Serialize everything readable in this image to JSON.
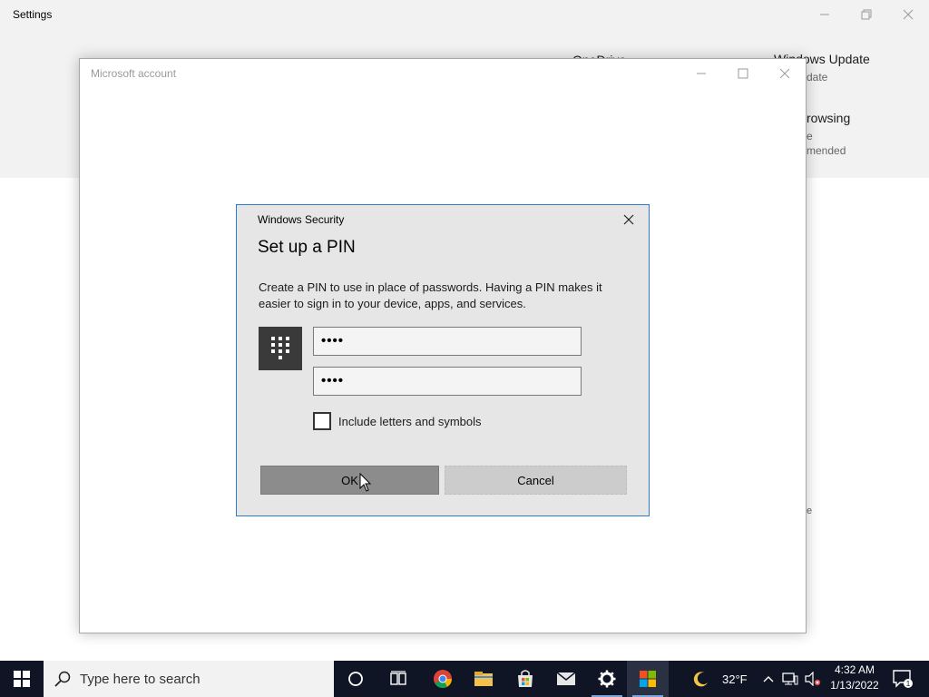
{
  "settings": {
    "title": "Settings",
    "bg_items": {
      "onedrive": "OneDrive",
      "windows_update_title": "Windows Update",
      "windows_update_sub": "date",
      "browsing_title": "rowsing",
      "browsing_sub1": "e",
      "browsing_sub2": "mended",
      "stray": "e"
    }
  },
  "ms_window": {
    "title": "Microsoft account"
  },
  "dialog": {
    "caption": "Windows Security",
    "heading": "Set up a PIN",
    "description": "Create a PIN to use in place of passwords. Having a PIN makes it easier to sign in to your device, apps, and services.",
    "pin_value": "••••",
    "confirm_pin_value": "••••",
    "checkbox_label": "Include letters and symbols",
    "checkbox_checked": false,
    "ok_label": "OK",
    "cancel_label": "Cancel"
  },
  "taskbar": {
    "search_placeholder": "Type here to search",
    "apps": [
      "cortana-icon",
      "task-view-icon",
      "chrome-icon",
      "file-explorer-icon",
      "microsoft-store-icon",
      "mail-icon",
      "settings-icon",
      "microsoft-account-icon"
    ],
    "weather_temp": "32°F",
    "time": "4:32 AM",
    "date": "1/13/2022",
    "notification_count": "1"
  },
  "colors": {
    "dialog_border": "#2b7bd4",
    "taskbar_bg": "#0f1524",
    "ok_button": "#8c8c8c"
  }
}
